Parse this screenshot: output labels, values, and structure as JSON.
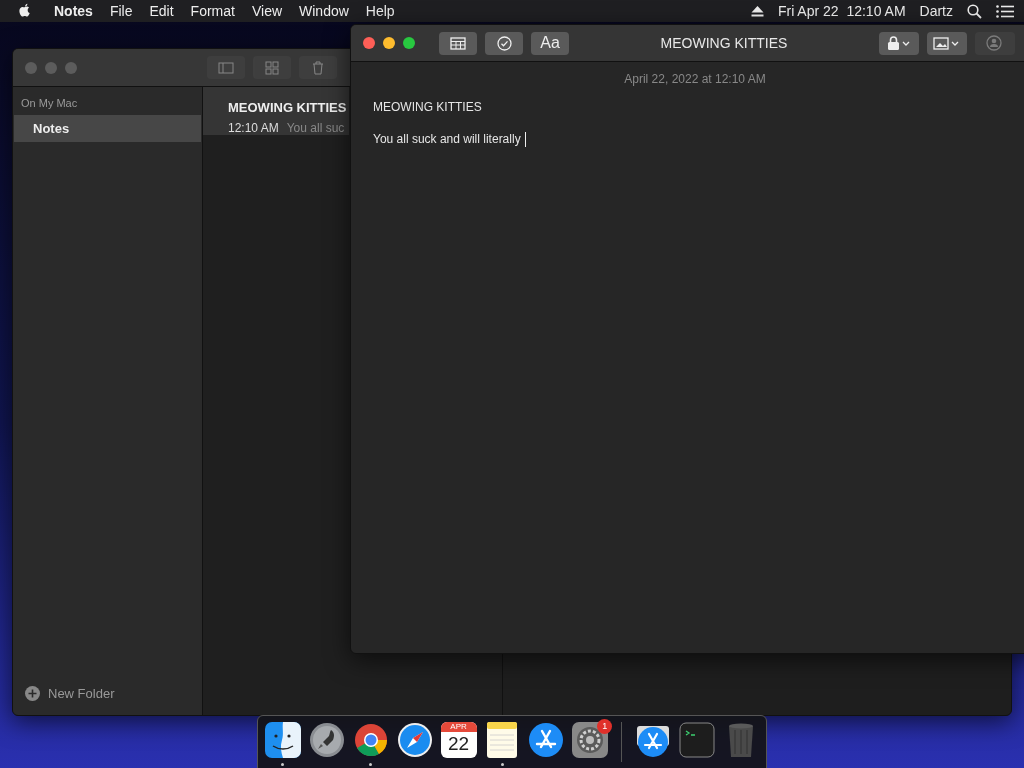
{
  "menu_bar": {
    "app_name": "Notes",
    "menus": [
      "File",
      "Edit",
      "Format",
      "View",
      "Window",
      "Help"
    ],
    "clock": "Fri Apr 22  12:10 AM",
    "user": "Dartz"
  },
  "folders_window": {
    "section": "On My Mac",
    "folders": [
      {
        "label": "Notes",
        "selected": true
      }
    ],
    "new_folder": "New Folder"
  },
  "note_list": [
    {
      "title": "MEOWING KITTIES",
      "time": "12:10 AM",
      "preview": "You all suc",
      "selected": true
    }
  ],
  "note_window": {
    "title": "MEOWING KITTIES",
    "format_button": "Aa",
    "date": "April 22, 2022 at 12:10 AM",
    "lines": [
      "MEOWING KITTIES",
      "You all suck and will literally"
    ]
  },
  "dock": [
    {
      "kind": "finder",
      "running": true
    },
    {
      "kind": "launchpad",
      "running": false
    },
    {
      "kind": "chrome",
      "running": true
    },
    {
      "kind": "safari",
      "running": false
    },
    {
      "kind": "calendar",
      "running": false,
      "month": "APR",
      "day": "22"
    },
    {
      "kind": "notes",
      "running": true
    },
    {
      "kind": "appstore",
      "running": false
    },
    {
      "kind": "settings",
      "running": false,
      "badge": "1"
    },
    {
      "kind": "separator"
    },
    {
      "kind": "downloads",
      "running": false
    },
    {
      "kind": "terminal",
      "running": false
    },
    {
      "kind": "trash",
      "running": false
    }
  ]
}
